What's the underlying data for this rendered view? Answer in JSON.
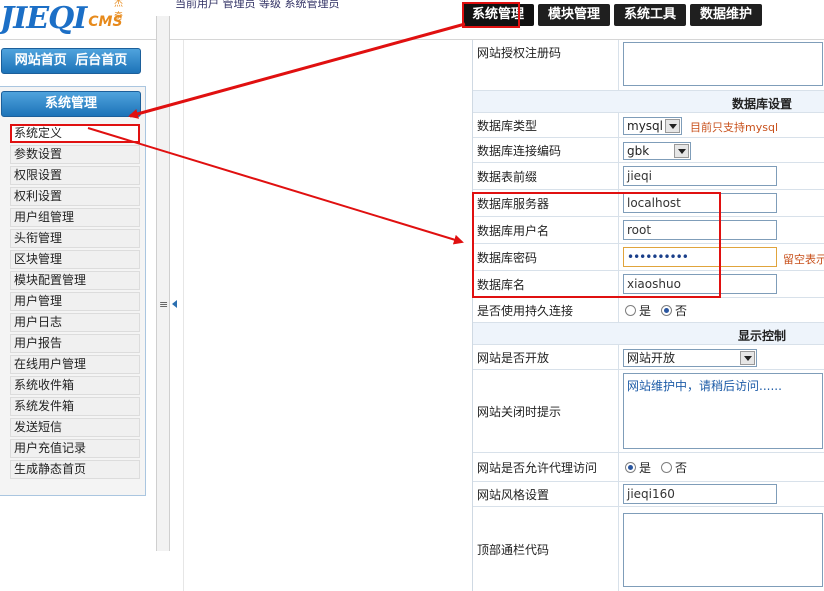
{
  "header": {
    "logo_main": "JIEQI",
    "logo_cms": "CMS",
    "logo_sub": "杰奇",
    "top_info": "当前用户  管理员  等级  系统管理员",
    "tabs": [
      "系统管理",
      "模块管理",
      "系统工具",
      "数据维护"
    ],
    "active_tab": "系统管理"
  },
  "sidebar": {
    "home_link": "网站首页",
    "admin_link": "后台首页",
    "menu_title": "系统管理",
    "grip": "≡",
    "items": [
      "系统定义",
      "参数设置",
      "权限设置",
      "权利设置",
      "用户组管理",
      "头衔管理",
      "区块管理",
      "模块配置管理",
      "用户管理",
      "用户日志",
      "用户报告",
      "在线用户管理",
      "系统收件箱",
      "系统发件箱",
      "发送短信",
      "用户充值记录",
      "生成静态首页"
    ],
    "selected_item": "系统定义"
  },
  "form": {
    "license": {
      "label": "网站授权注册码",
      "value": ""
    },
    "db_section": "数据库设置",
    "db_type": {
      "label": "数据库类型",
      "value": "mysql",
      "hint": "目前只支持mysql"
    },
    "db_charset": {
      "label": "数据库连接编码",
      "value": "gbk"
    },
    "db_prefix": {
      "label": "数据表前缀",
      "value": "jieqi"
    },
    "db_host": {
      "label": "数据库服务器",
      "value": "localhost"
    },
    "db_user": {
      "label": "数据库用户名",
      "value": "root"
    },
    "db_pass": {
      "label": "数据库密码",
      "value": "••••••••••",
      "hint": "留空表示"
    },
    "db_name": {
      "label": "数据库名",
      "value": "xiaoshuo"
    },
    "db_persist": {
      "label": "是否使用持久连接",
      "opt_yes": "是",
      "opt_no": "否",
      "selected": "否"
    },
    "display_section": "显示控制",
    "site_open": {
      "label": "网站是否开放",
      "value": "网站开放"
    },
    "close_msg": {
      "label": "网站关闭时提示",
      "value": "网站维护中，请稍后访问......"
    },
    "proxy": {
      "label": "网站是否允许代理访问",
      "opt_yes": "是",
      "opt_no": "否",
      "selected": "是"
    },
    "theme": {
      "label": "网站风格设置",
      "value": "jieqi160"
    },
    "topbar": {
      "label": "顶部通栏代码",
      "value": ""
    }
  },
  "colors": {
    "accent_blue": "#1d73b8",
    "highlight_red": "#e01010",
    "hint_orange": "#c8501b"
  }
}
